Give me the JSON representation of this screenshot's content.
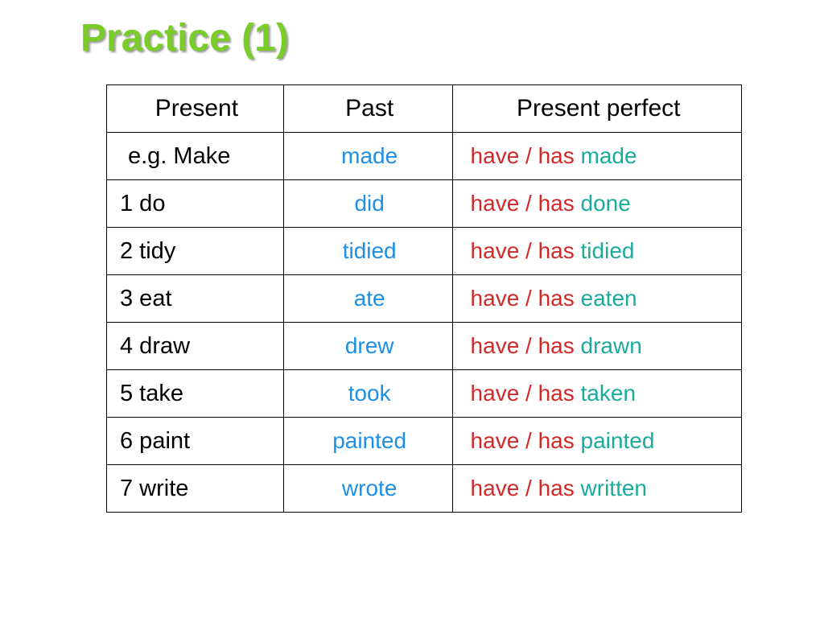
{
  "title": "Practice (1)",
  "headers": {
    "present": "Present",
    "past": "Past",
    "present_perfect": "Present perfect"
  },
  "pp_prefix": "have / has",
  "rows": [
    {
      "label": "e.g. Make",
      "past": "made",
      "participle": "made",
      "example": true
    },
    {
      "label": "1  do",
      "past": "did",
      "participle": "done",
      "example": false
    },
    {
      "label": "2  tidy",
      "past": "tidied",
      "participle": "tidied",
      "example": false
    },
    {
      "label": "3  eat",
      "past": "ate",
      "participle": "eaten",
      "example": false
    },
    {
      "label": "4  draw",
      "past": "drew",
      "participle": "drawn",
      "example": false
    },
    {
      "label": "5  take",
      "past": "took",
      "participle": "taken",
      "example": false
    },
    {
      "label": "6  paint",
      "past": "painted",
      "participle": "painted",
      "example": false
    },
    {
      "label": "7  write",
      "past": "wrote",
      "participle": "written",
      "example": false
    }
  ]
}
